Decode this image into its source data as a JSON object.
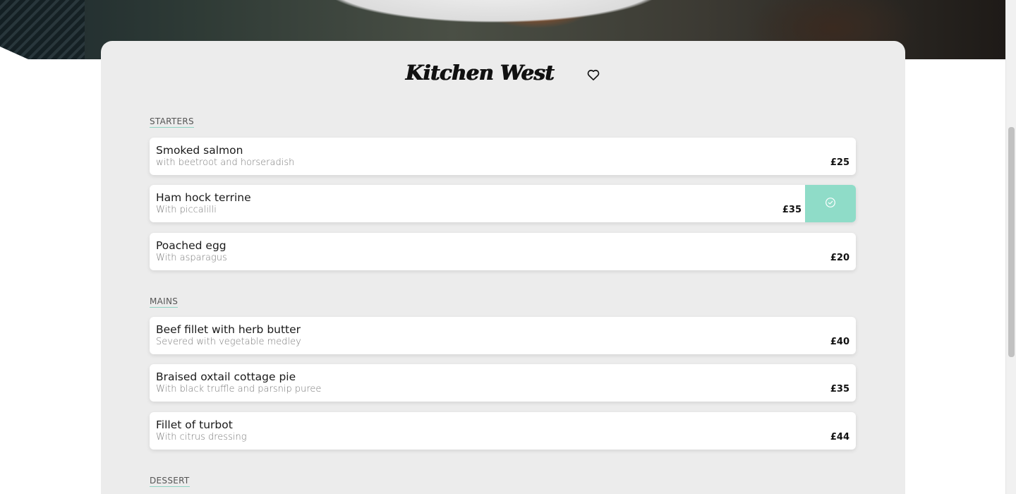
{
  "restaurant": {
    "name": "Kitchen West",
    "favorite_icon": "heart-outline-icon"
  },
  "sections": [
    {
      "label": "STARTERS",
      "items": [
        {
          "name": "Smoked salmon",
          "desc": "with beetroot and horseradish",
          "price": "£25",
          "selected": false
        },
        {
          "name": "Ham hock terrine",
          "desc": "With piccalilli",
          "price": "£35",
          "selected": true
        },
        {
          "name": "Poached egg",
          "desc": "With asparagus",
          "price": "£20",
          "selected": false
        }
      ]
    },
    {
      "label": "MAINS",
      "items": [
        {
          "name": "Beef fillet with herb butter",
          "desc": "Severed with vegetable medley",
          "price": "£40",
          "selected": false
        },
        {
          "name": "Braised oxtail cottage pie",
          "desc": "With black truffle and parsnip puree",
          "price": "£35",
          "selected": false
        },
        {
          "name": "Fillet of turbot",
          "desc": "With citrus dressing",
          "price": "£44",
          "selected": false
        }
      ]
    },
    {
      "label": "DESSERT",
      "items": []
    }
  ],
  "colors": {
    "accent": "#8fdcc8",
    "card_bg": "#ececec",
    "item_bg": "#ffffff"
  }
}
